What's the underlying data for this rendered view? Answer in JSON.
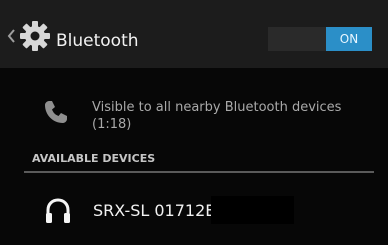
{
  "action_bar": {
    "title": "Bluetooth",
    "back_icon": "chevron-left-icon",
    "app_icon": "gear-icon",
    "toggle_label": "ON"
  },
  "visibility": {
    "icon": "phone-icon",
    "text": "Visible to all nearby Bluetooth devices (1:18)"
  },
  "available_devices": {
    "header": "AVAILABLE DEVICES",
    "items": [
      {
        "name": "SRX-SL 01712E",
        "icon": "headphones-icon"
      }
    ]
  },
  "colors": {
    "accent": "#2b8fc8",
    "background": "#070707",
    "action_bar": "#1c1c1c",
    "primary_text": "#f2f2f2",
    "secondary_text": "#a9a9a9"
  }
}
